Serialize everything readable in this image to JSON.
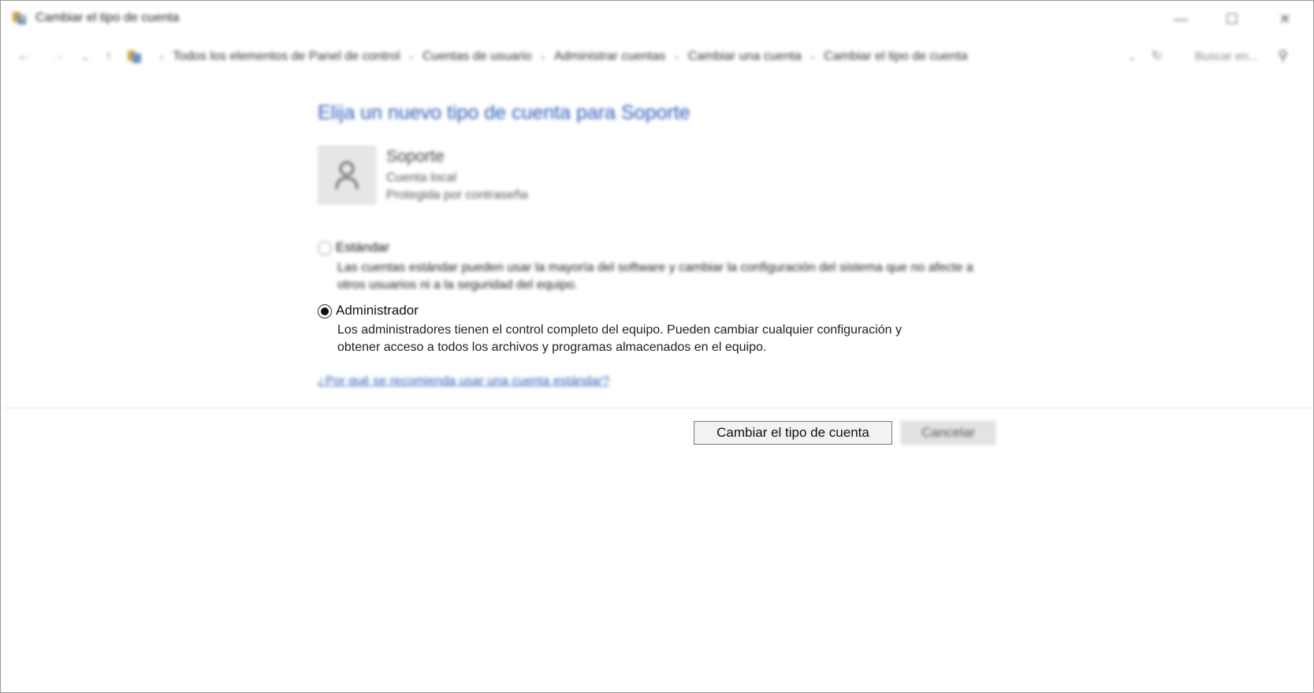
{
  "window": {
    "title": "Cambiar el tipo de cuenta",
    "controls": {
      "minimize_icon": "minimize-icon",
      "maximize_icon": "maximize-icon",
      "close_icon": "close-icon"
    }
  },
  "navigation": {
    "breadcrumb": [
      "Todos los elementos de Panel de control",
      "Cuentas de usuario",
      "Administrar cuentas",
      "Cambiar una cuenta",
      "Cambiar el tipo de cuenta"
    ],
    "search_placeholder": "Buscar en..."
  },
  "content": {
    "heading": "Elija un nuevo tipo de cuenta para Soporte",
    "account": {
      "name": "Soporte",
      "type": "Cuenta local",
      "protection": "Protegida por contraseña"
    },
    "options": [
      {
        "label": "Estándar",
        "description": "Las cuentas estándar pueden usar la mayoría del software y cambiar la configuración del sistema que no afecte a otros usuarios ni a la seguridad del equipo.",
        "selected": false
      },
      {
        "label": "Administrador",
        "description_line1": "Los administradores tienen el control completo del equipo. Pueden cambiar cualquier configuración y",
        "description_line2": "obtener acceso a todos los archivos y programas almacenados en el equipo.",
        "selected": true
      }
    ],
    "help_link": "¿Por qué se recomienda usar una cuenta estándar?"
  },
  "buttons": {
    "change": "Cambiar el tipo de cuenta",
    "cancel": "Cancelar"
  },
  "colors": {
    "heading": "#2a5ab8",
    "link": "#2a5ab8"
  }
}
